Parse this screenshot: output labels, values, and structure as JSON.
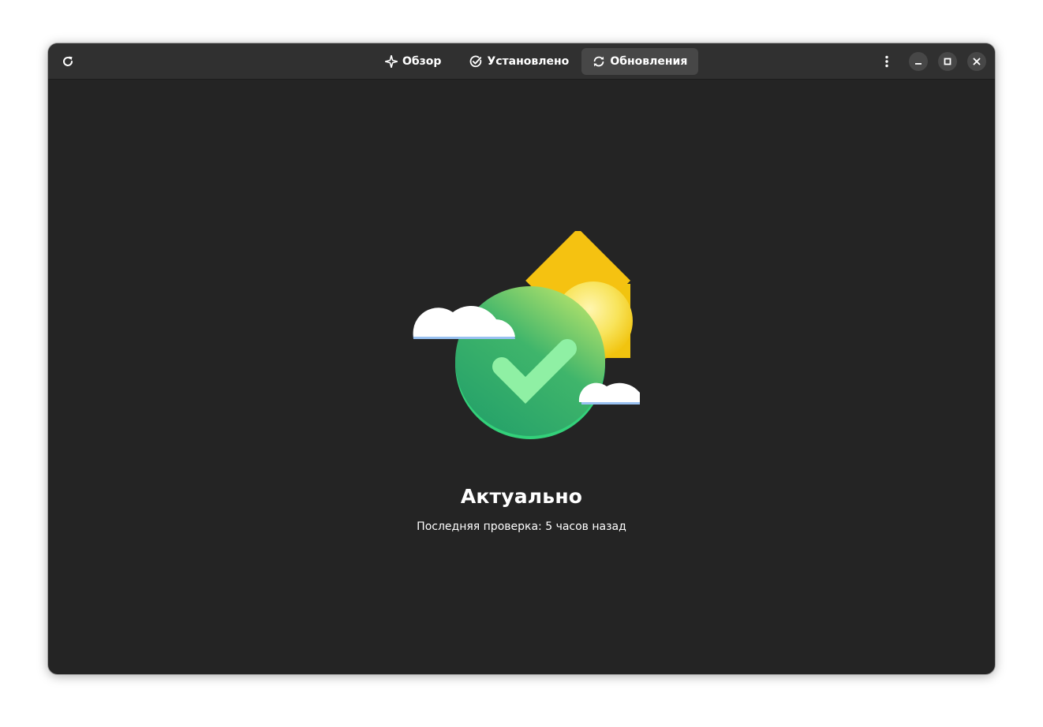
{
  "headerbar": {
    "refresh_icon": "refresh-icon",
    "tabs": [
      {
        "label": "Обзор",
        "icon": "sparkle-icon",
        "active": false
      },
      {
        "label": "Установлено",
        "icon": "check-circle-icon",
        "active": false
      },
      {
        "label": "Обновления",
        "icon": "sync-icon",
        "active": true
      }
    ],
    "menu_icon": "kebab-menu-icon",
    "window_controls": [
      "minimize-icon",
      "maximize-icon",
      "close-icon"
    ]
  },
  "status": {
    "title": "Актуально",
    "subtitle": "Последняя проверка: 5 часов назад"
  },
  "colors": {
    "window_bg": "#242424",
    "headerbar_bg": "#303030",
    "active_tab_bg": "#474747",
    "text": "#ffffff",
    "badge_green": "#2aa86a",
    "check_green": "#8ff0a4",
    "sun_yellow": "#f6d32d"
  }
}
